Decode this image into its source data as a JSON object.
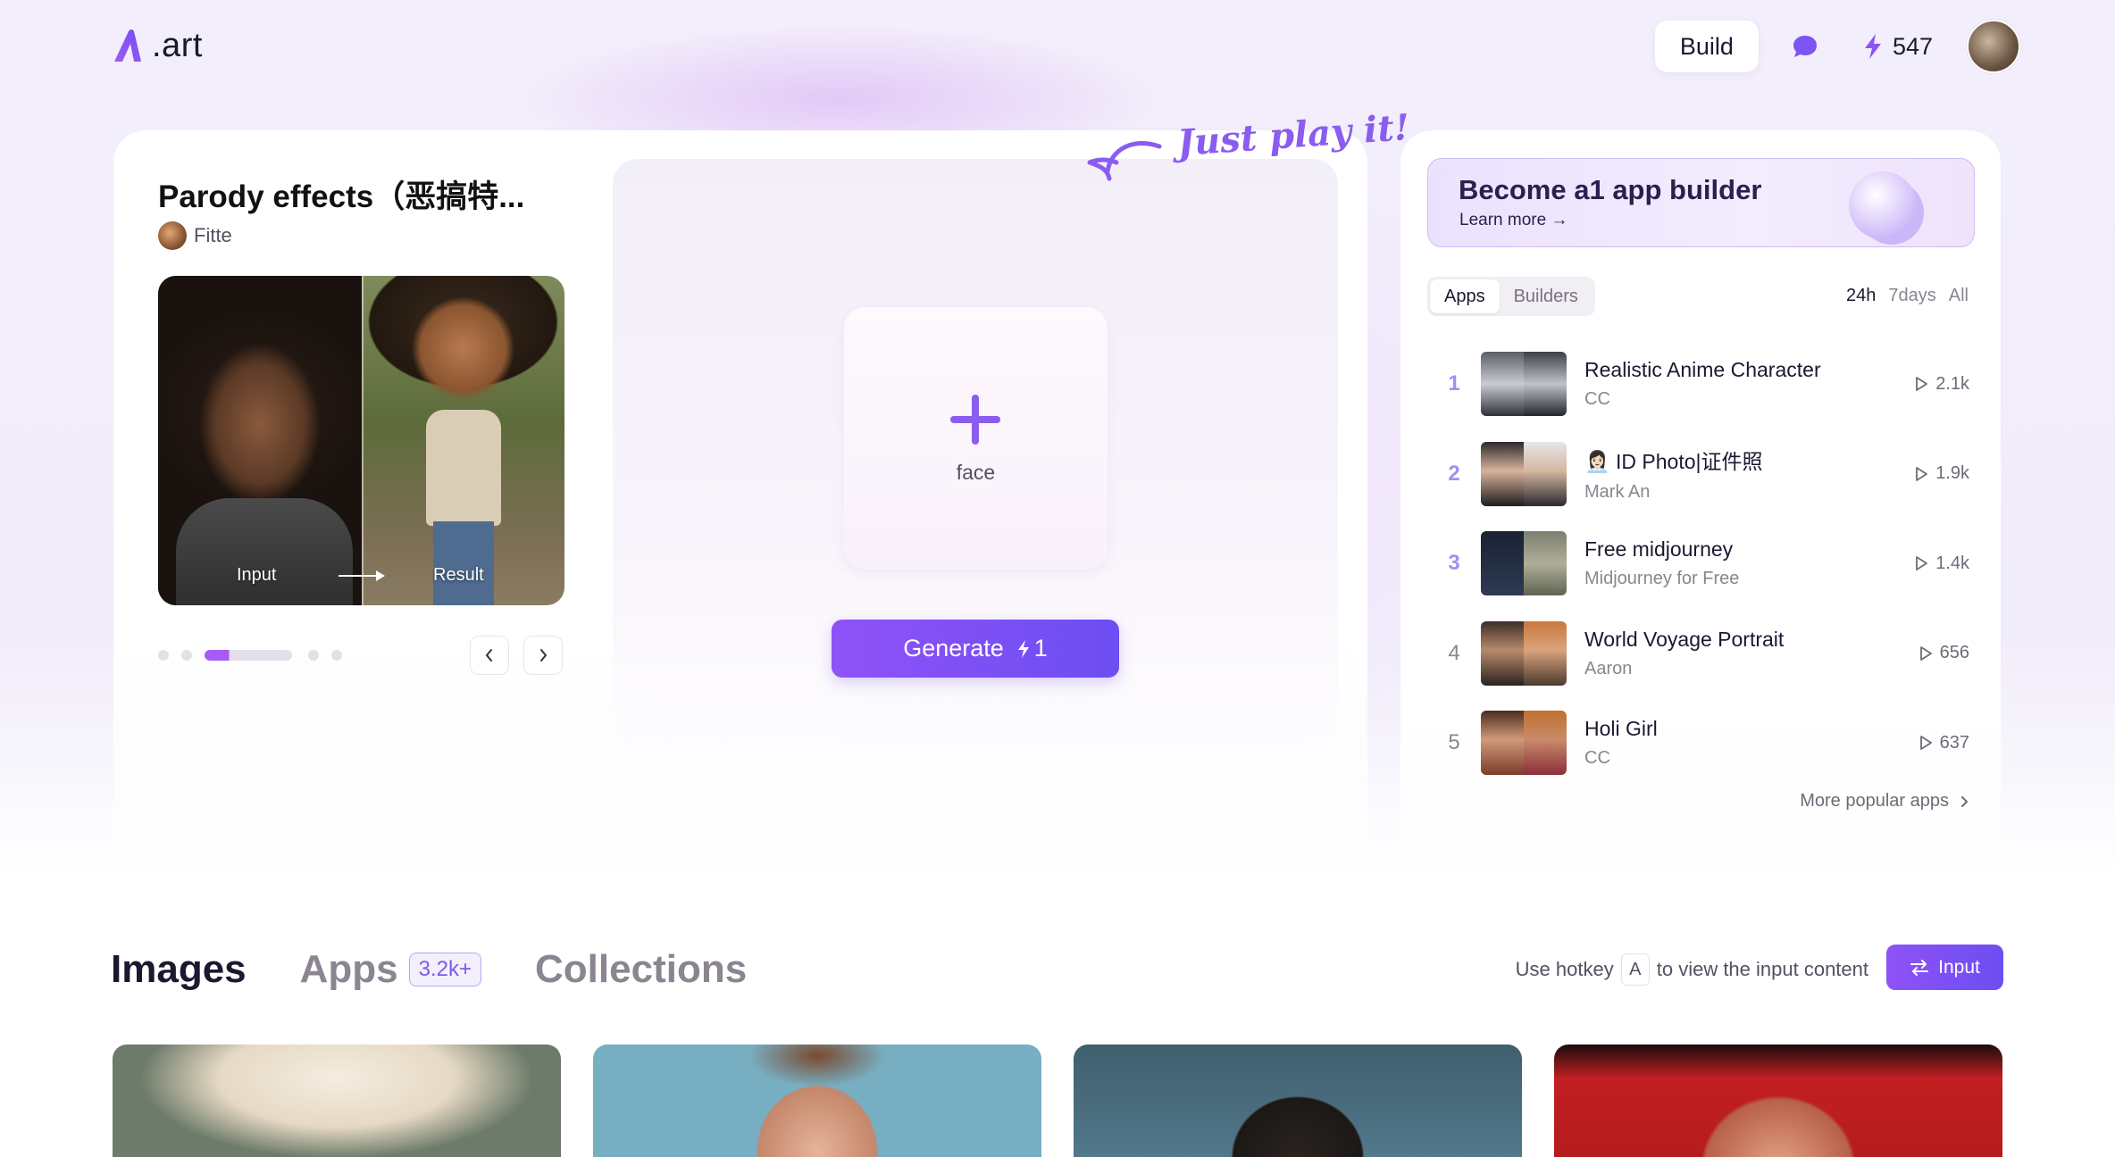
{
  "header": {
    "logo_text": ".art",
    "build_label": "Build",
    "credits": "547",
    "message_icon": "chat-bubble-icon",
    "credit_icon": "lightning-icon"
  },
  "app": {
    "title": "Parody effects（恶搞特...",
    "author": "Fitte",
    "preview_input_label": "Input",
    "preview_result_label": "Result",
    "carousel_active_index": 2,
    "carousel_count": 5,
    "upload_label": "face",
    "generate_label": "Generate",
    "generate_cost": "1",
    "annotation": "Just play it!"
  },
  "promo": {
    "title": "Become a1 app builder",
    "link": "Learn more →"
  },
  "ranking": {
    "tabs": [
      "Apps",
      "Builders"
    ],
    "active_tab": "Apps",
    "ranges": [
      "24h",
      "7days",
      "All"
    ],
    "active_range": "24h",
    "items": [
      {
        "rank": "1",
        "name": "Realistic Anime Character",
        "author": "CC",
        "plays": "2.1k"
      },
      {
        "rank": "2",
        "name": "👩🏻‍💼 ID Photo|证件照",
        "author": "Mark An",
        "plays": "1.9k"
      },
      {
        "rank": "3",
        "name": "Free midjourney",
        "author": "Midjourney for Free",
        "plays": "1.4k"
      },
      {
        "rank": "4",
        "name": "World Voyage Portrait",
        "author": "Aaron",
        "plays": "656"
      },
      {
        "rank": "5",
        "name": "Holi Girl",
        "author": "CC",
        "plays": "637"
      }
    ],
    "more_label": "More popular apps"
  },
  "feed": {
    "tabs": [
      "Images",
      "Apps",
      "Collections"
    ],
    "active_tab": "Images",
    "apps_badge": "3.2k+",
    "hotkey_prefix": "Use hotkey",
    "hotkey_key": "A",
    "hotkey_suffix": "to view the input content",
    "input_button": "Input"
  },
  "colors": {
    "accent": "#7c54f4",
    "accent_light": "#a08ff0"
  }
}
